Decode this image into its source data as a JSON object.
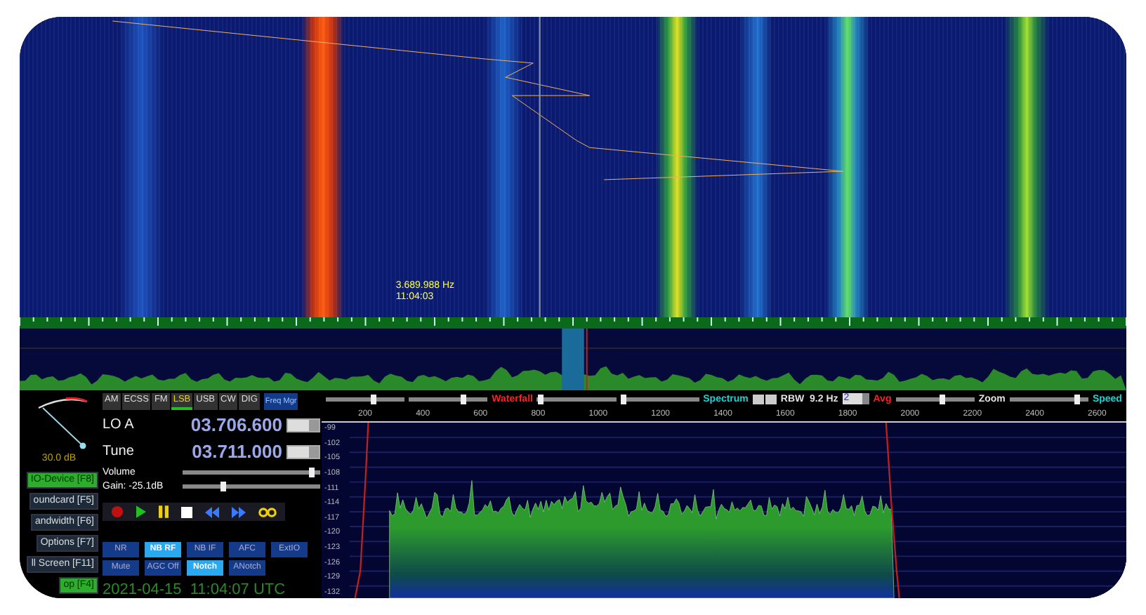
{
  "waterfall": {
    "marker": {
      "frequency": "3.689.988 Hz",
      "time": "11:04:03"
    }
  },
  "controls": {
    "meter": {
      "reading": "30.0 dB"
    },
    "functions": [
      {
        "label": "IO-Device [F8]",
        "highlighted": true
      },
      {
        "label": "oundcard [F5]",
        "highlighted": false
      },
      {
        "label": "andwidth [F6]",
        "highlighted": false
      },
      {
        "label": "Options [F7]",
        "highlighted": false
      },
      {
        "label": "ll Screen [F11]",
        "highlighted": false
      },
      {
        "label": "op [F4]",
        "highlighted": true
      }
    ],
    "modes": [
      {
        "label": "AM",
        "selected": false
      },
      {
        "label": "ECSS",
        "selected": false
      },
      {
        "label": "FM",
        "selected": false
      },
      {
        "label": "LSB",
        "selected": true
      },
      {
        "label": "USB",
        "selected": false
      },
      {
        "label": "CW",
        "selected": false
      },
      {
        "label": "DIG",
        "selected": false
      }
    ],
    "freq_manager": "Freq Mgr",
    "lo": {
      "label": "LO A",
      "value": "03.706.600"
    },
    "tune": {
      "label": "Tune",
      "value": "03.711.000"
    },
    "volume": {
      "label": "Volume",
      "level": 0.94
    },
    "gain": {
      "label": "Gain: -25.1dB",
      "level": 0.3
    },
    "transport": [
      {
        "kind": "record"
      },
      {
        "kind": "play"
      },
      {
        "kind": "pause"
      },
      {
        "kind": "stop"
      },
      {
        "kind": "rewind"
      },
      {
        "kind": "forward"
      },
      {
        "kind": "loop"
      }
    ],
    "dsp_row1": [
      {
        "label": "NR",
        "selected": false
      },
      {
        "label": "NB RF",
        "selected": true
      },
      {
        "label": "NB IF",
        "selected": false
      },
      {
        "label": "AFC",
        "selected": false
      },
      {
        "label": "ExtIO",
        "selected": false
      }
    ],
    "dsp_row2": [
      {
        "label": "Mute",
        "selected": false
      },
      {
        "label": "AGC Off",
        "selected": false
      },
      {
        "label": "Notch",
        "selected": true
      },
      {
        "label": "ANotch",
        "selected": false
      }
    ],
    "timestamp": "2021-04-15  11:04:07 UTC"
  },
  "spectrum": {
    "toolbar": [
      {
        "kind": "slider",
        "level": 0.6
      },
      {
        "kind": "slider",
        "level": 0.7
      },
      {
        "kind": "label",
        "text": "Waterfall",
        "color": "#ff2020"
      },
      {
        "kind": "slider",
        "level": 0.05
      },
      {
        "kind": "slider",
        "level": 0.05
      },
      {
        "kind": "label",
        "text": "Spectrum",
        "color": "#20d0d0"
      },
      {
        "kind": "stepper"
      },
      {
        "kind": "label",
        "text": "RBW  9.2 Hz",
        "color": "#e0e0e0"
      },
      {
        "kind": "select",
        "text": "2"
      },
      {
        "kind": "label",
        "text": "Avg",
        "color": "#ff2020"
      },
      {
        "kind": "slider",
        "level": 0.6
      },
      {
        "kind": "label",
        "text": "Zoom",
        "color": "#e0e0e0"
      },
      {
        "kind": "slider",
        "level": 0.85
      },
      {
        "kind": "label",
        "text": "Speed",
        "color": "#20d0d0"
      }
    ],
    "x_ticks": [
      "200",
      "400",
      "600",
      "800",
      "1000",
      "1200",
      "1400",
      "1600",
      "1800",
      "2000",
      "2200",
      "2400",
      "2600"
    ],
    "y_ticks": [
      "-99",
      "-102",
      "-105",
      "-108",
      "-111",
      "-114",
      "-117",
      "-120",
      "-123",
      "-126",
      "-129",
      "-132"
    ]
  }
}
